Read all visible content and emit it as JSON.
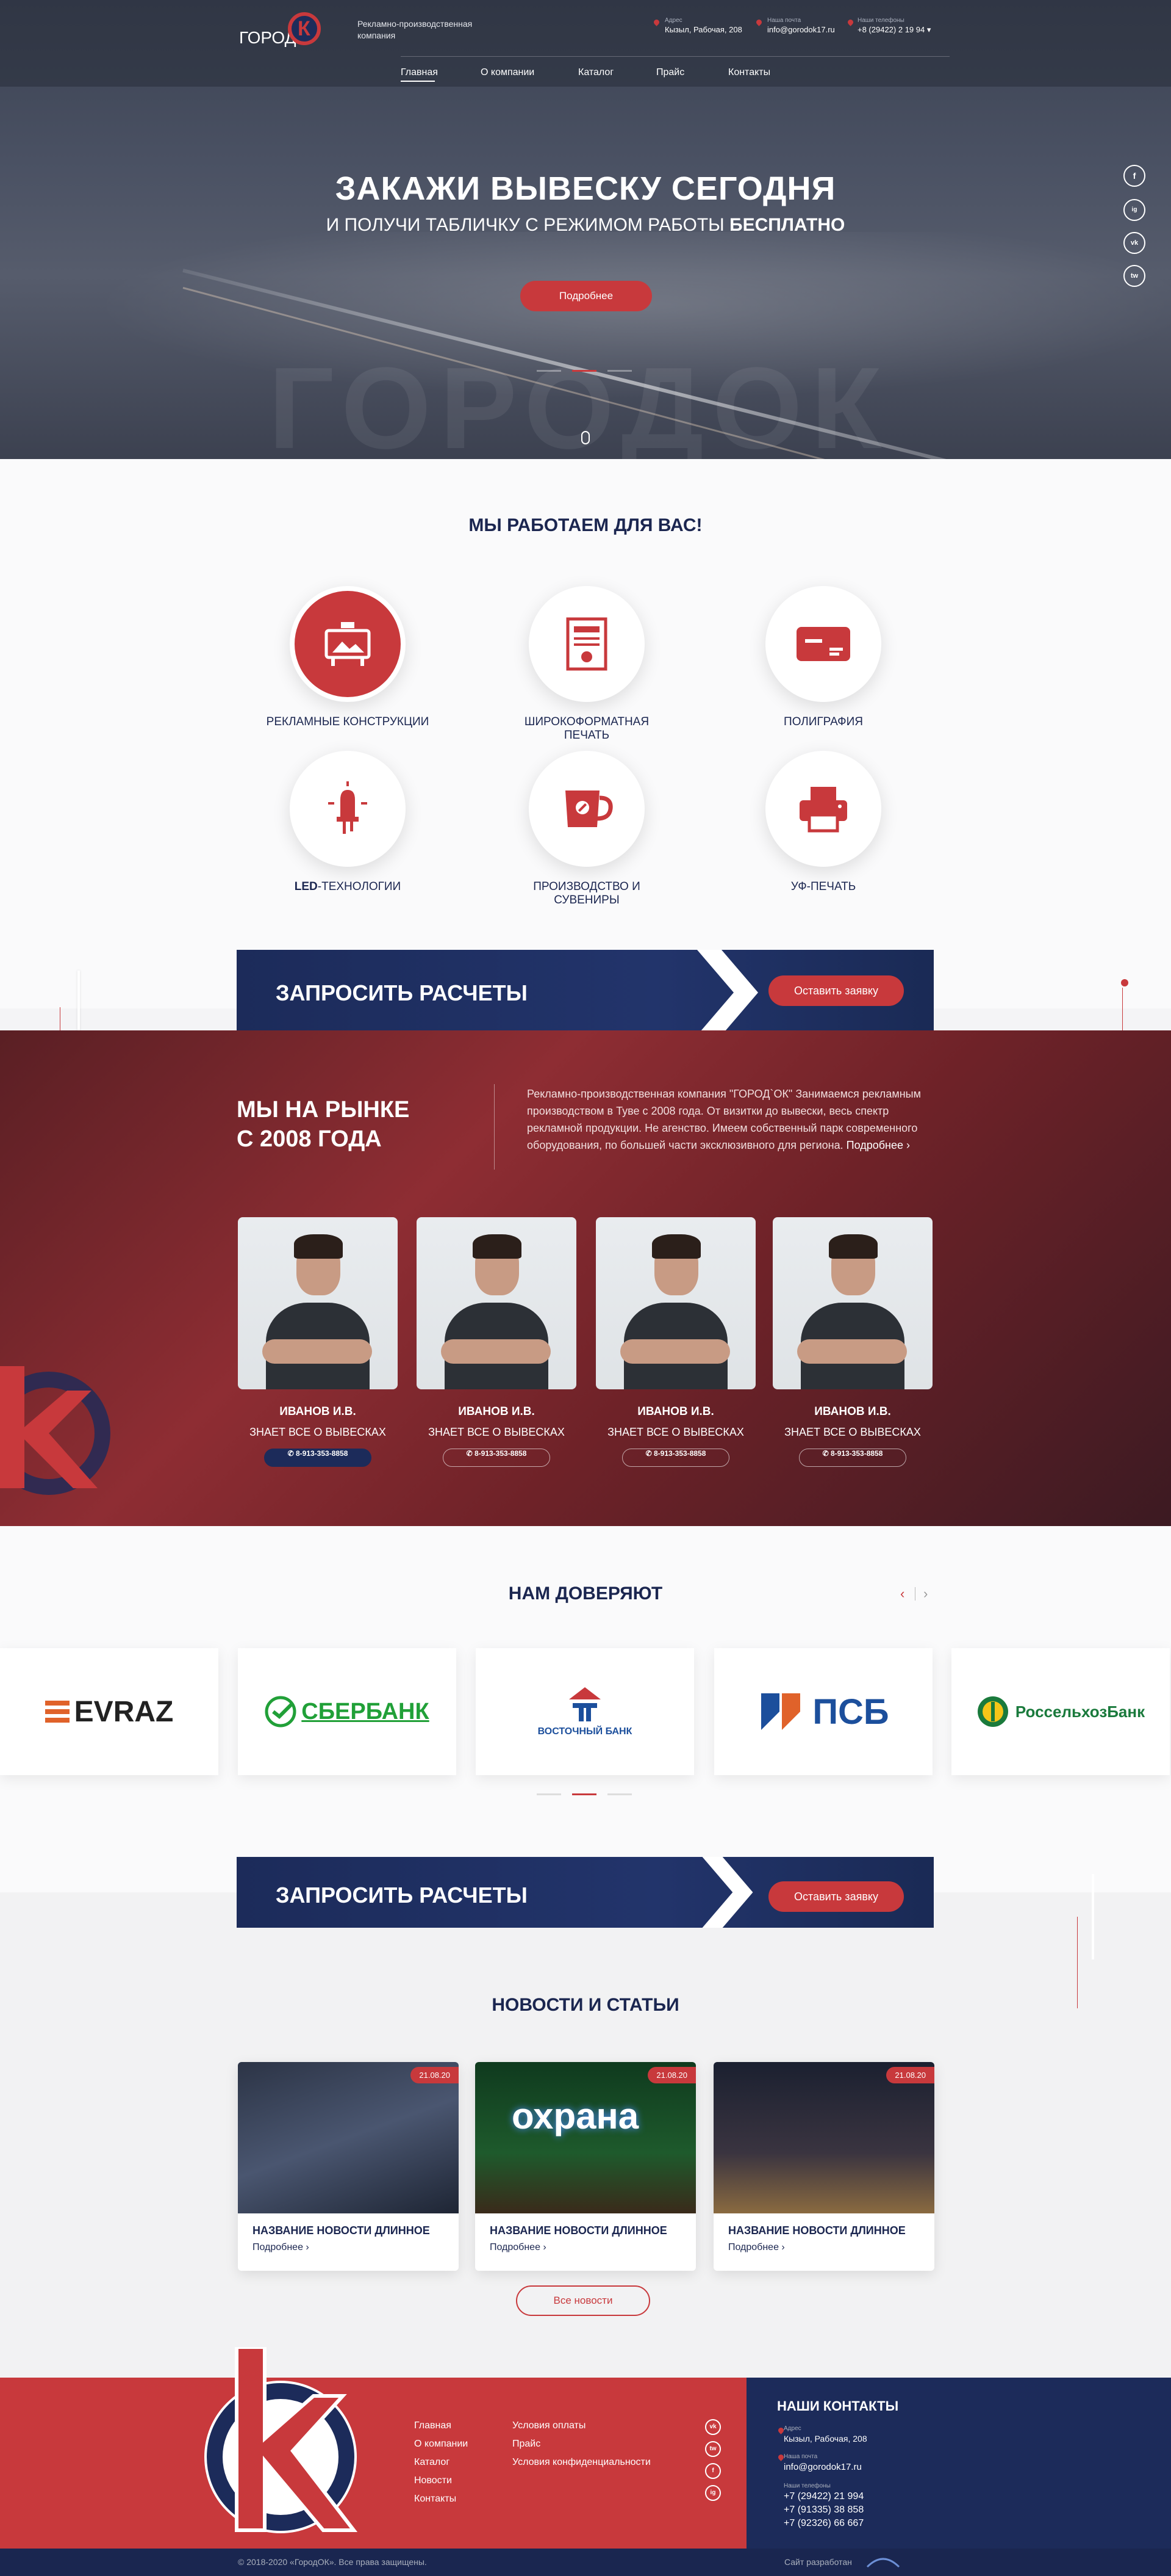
{
  "header": {
    "logo_text": "ГОРОД",
    "logo_letter": "К",
    "tagline": "Рекламно-производственная компания",
    "address_label": "Адрес",
    "address": "Кызыл, Рабочая, 208",
    "email_label": "Наша почта",
    "email": "info@gorodok17.ru",
    "phone_label": "Наши телефоны",
    "phone": "+8 (29422) 2 19 94",
    "nav": [
      "Главная",
      "О компании",
      "Каталог",
      "Прайс",
      "Контакты"
    ]
  },
  "hero": {
    "title": "ЗАКАЖИ ВЫВЕСКУ СЕГОДНЯ",
    "subtitle_pre": "И ПОЛУЧИ ТАБЛИЧКУ С РЕЖИМОМ РАБОТЫ ",
    "subtitle_bold": "БЕСПЛАТНО",
    "button": "Подробнее",
    "watermark": "ГОРОДОК",
    "social": [
      "f",
      "ig",
      "vk",
      "tw"
    ]
  },
  "services": {
    "title": "МЫ РАБОТАЕМ ДЛЯ ВАС!",
    "items": [
      {
        "label": "РЕКЛАМНЫЕ КОНСТРУКЦИИ",
        "icon": "billboard-icon"
      },
      {
        "label": "ШИРОКОФОРМАТНАЯ ПЕЧАТЬ",
        "icon": "poster-icon"
      },
      {
        "label": "ПОЛИГРАФИЯ",
        "icon": "business-card-icon"
      },
      {
        "label_bold": "LED",
        "label": "-ТЕХНОЛОГИИ",
        "icon": "led-icon"
      },
      {
        "label": "ПРОИЗВОДСТВО И СУВЕНИРЫ",
        "icon": "mug-icon"
      },
      {
        "label": "УФ-ПЕЧАТЬ",
        "icon": "printer-icon"
      }
    ]
  },
  "cta": {
    "text": "ЗАПРОСИТЬ РАСЧЕТЫ",
    "button": "Оставить заявку"
  },
  "team": {
    "title_line1": "МЫ НА РЫНКЕ",
    "title_line2": "С 2008 ГОДА",
    "text": "Рекламно-производственная компания \"ГОРОД`ОК\" Занимаемся рекламным производством в Туве с 2008 года. От визитки до вывески, весь спектр рекламной продукции. Не агенство. Имеем собственный парк современного оборудования, по большей части эксклюзивного для региона.",
    "more": "Подробнее",
    "members": [
      {
        "name": "ИВАНОВ И.В.",
        "role": "ЗНАЕТ ВСЕ О ВЫВЕСКАХ",
        "phone": "8-913-353-8858"
      },
      {
        "name": "ИВАНОВ И.В.",
        "role": "ЗНАЕТ ВСЕ О ВЫВЕСКАХ",
        "phone": "8-913-353-8858"
      },
      {
        "name": "ИВАНОВ И.В.",
        "role": "ЗНАЕТ ВСЕ О ВЫВЕСКАХ",
        "phone": "8-913-353-8858"
      },
      {
        "name": "ИВАНОВ И.В.",
        "role": "ЗНАЕТ ВСЕ О ВЫВЕСКАХ",
        "phone": "8-913-353-8858"
      }
    ]
  },
  "trust": {
    "title": "НАМ ДОВЕРЯЮТ",
    "logos": [
      "EVRAZ",
      "СБЕРБАНК",
      "ВОСТОЧНЫЙ БАНК",
      "ПСБ",
      "РоссельхозБанк"
    ]
  },
  "news": {
    "title": "НОВОСТИ И СТАТЬИ",
    "items": [
      {
        "date": "21.08.20",
        "title": "НАЗВАНИЕ НОВОСТИ ДЛИННОЕ",
        "more": "Подробнее"
      },
      {
        "date": "21.08.20",
        "title": "НАЗВАНИЕ НОВОСТИ ДЛИННОЕ",
        "more": "Подробнее",
        "sign": "охрана"
      },
      {
        "date": "21.08.20",
        "title": "НАЗВАНИЕ НОВОСТИ ДЛИННОЕ",
        "more": "Подробнее"
      }
    ],
    "all_button": "Все новости"
  },
  "footer": {
    "nav": [
      "Главная",
      "О компании",
      "Каталог",
      "Новости",
      "Контакты"
    ],
    "links": [
      "Условия оплаты",
      "Прайс",
      "Условия конфиденциальности"
    ],
    "contacts_title": "НАШИ КОНТАКТЫ",
    "address_label": "Адрес",
    "address": "Кызыл, Рабочая, 208",
    "email_label": "Наша почта",
    "email": "info@gorodok17.ru",
    "phones_label": "Наши телефоны",
    "phones": [
      "+7 (29422) 21 994",
      "+7 (91335) 38 858",
      "+7 (92326) 66 667"
    ],
    "copyright": "© 2018-2020 «ГородОК». Все права защищены.",
    "developer": "Сайт разработан"
  },
  "colors": {
    "accent": "#c8393c",
    "navy": "#1c2b5a"
  }
}
